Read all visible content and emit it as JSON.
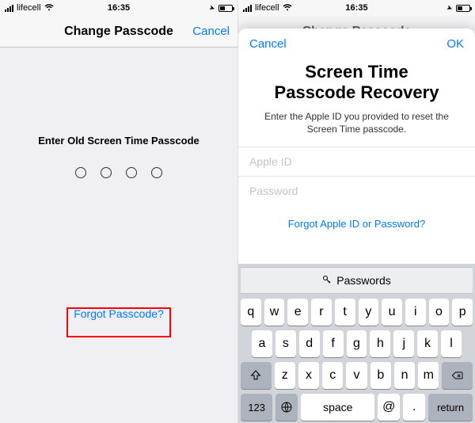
{
  "status": {
    "carrier": "lifecell",
    "time": "16:35",
    "locationGlyph": "➤"
  },
  "screen1": {
    "title": "Change Passcode",
    "cancel": "Cancel",
    "prompt": "Enter Old Screen Time Passcode",
    "forgot": "Forgot Passcode?"
  },
  "screen2": {
    "dimmedTitle": "Change Passcode",
    "sheet": {
      "cancel": "Cancel",
      "ok": "OK",
      "title1": "Screen Time",
      "title2": "Passcode Recovery",
      "subtitle": "Enter the Apple ID you provided to reset the Screen Time passcode.",
      "appleIdPlaceholder": "Apple ID",
      "passwordPlaceholder": "Password",
      "forgot": "Forgot Apple ID or Password?"
    },
    "keyboard": {
      "suggestion": "Passwords",
      "row1": [
        "q",
        "w",
        "e",
        "r",
        "t",
        "y",
        "u",
        "i",
        "o",
        "p"
      ],
      "row2": [
        "a",
        "s",
        "d",
        "f",
        "g",
        "h",
        "j",
        "k",
        "l"
      ],
      "row3": [
        "z",
        "x",
        "c",
        "v",
        "b",
        "n",
        "m"
      ],
      "numKey": "123",
      "space": "space",
      "at": "@",
      "dot": ".",
      "return": "return"
    }
  }
}
